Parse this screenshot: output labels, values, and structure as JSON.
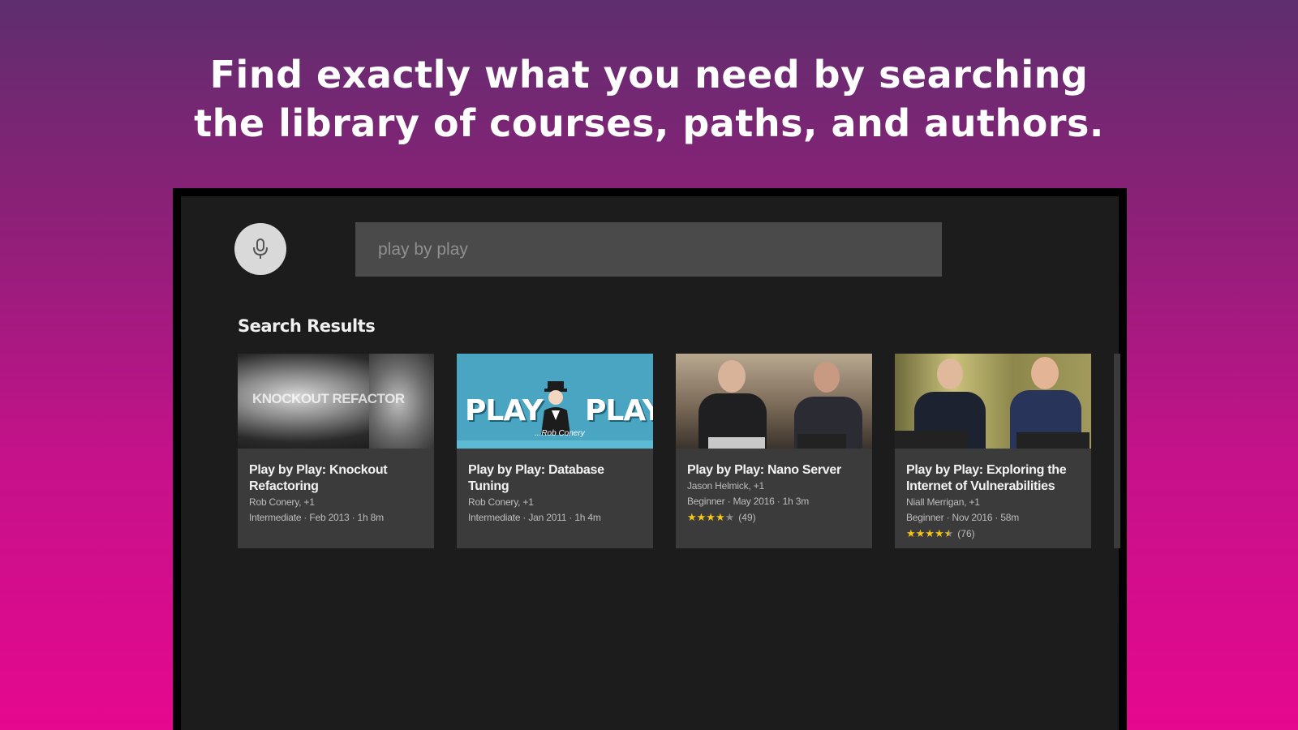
{
  "headline": {
    "line1": "Find exactly what you need by searching",
    "line2": "the library of courses, paths, and authors."
  },
  "search": {
    "query": "play by play"
  },
  "section_title": "Search Results",
  "thumbnail_texts": {
    "knockout": "KNOCKOUT REFACTOR",
    "play_left": "PLAY",
    "play_right": "PLAY",
    "play_sub": "...Rob Conery"
  },
  "results": [
    {
      "title": "Play by Play: Knockout Refactoring",
      "authors": "Rob Conery, +1",
      "details": "Intermediate · Feb 2013 · 1h 8m"
    },
    {
      "title": "Play by Play: Database Tuning",
      "authors": "Rob Conery, +1",
      "details": "Intermediate · Jan 2011 · 1h 4m"
    },
    {
      "title": "Play by Play: Nano Server",
      "authors": "Jason Helmick, +1",
      "details": "Beginner · May 2016 · 1h 3m",
      "rating": 4,
      "rating_count": "(49)"
    },
    {
      "title": "Play by Play: Exploring the Internet of Vulnerabilities",
      "authors": "Niall Merrigan, +1",
      "details": "Beginner · Nov 2016 · 58m",
      "rating": 4.5,
      "rating_count": "(76)"
    }
  ],
  "icons": {
    "voice_search": "microphone-icon",
    "star": "star-icon"
  },
  "colors": {
    "gradient_top": "#5e2e6e",
    "gradient_bottom": "#e6088f",
    "panel": "#1c1c1c",
    "card": "#3b3b3b",
    "star": "#f5c518"
  }
}
